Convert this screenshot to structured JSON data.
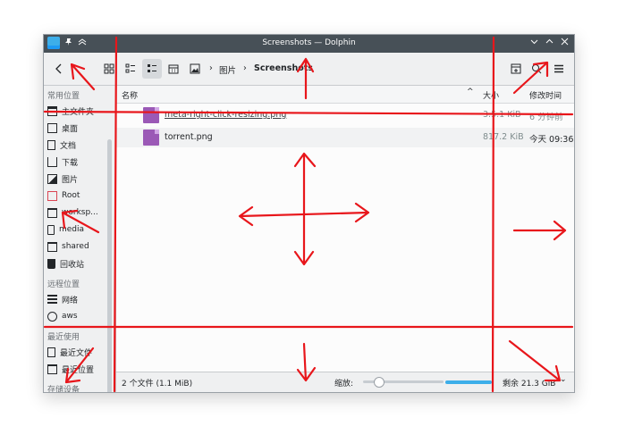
{
  "window": {
    "title": "Screenshots — Dolphin"
  },
  "breadcrumb": {
    "parent": "图片",
    "current": "Screenshots"
  },
  "sidebar": {
    "sections": [
      {
        "heading": "常用位置",
        "items": [
          "主文件夹",
          "桌面",
          "文档",
          "下载",
          "图片",
          "Root",
          "worksp...",
          "media",
          "shared",
          "回收站"
        ]
      },
      {
        "heading": "远程位置",
        "items": [
          "网络",
          "aws"
        ]
      },
      {
        "heading": "最近使用",
        "items": [
          "最近文件",
          "最近位置"
        ]
      },
      {
        "heading": "存储设备",
        "items": []
      }
    ]
  },
  "columns": {
    "name": "名称",
    "size": "大小",
    "modified": "修改时间"
  },
  "files": [
    {
      "name": "meta-right-click-resizing.png",
      "size": "3.5.1 KiB",
      "modified": "6 分钟前"
    },
    {
      "name": "torrent.png",
      "size": "817.2 KiB",
      "modified": "今天 09:36"
    }
  ],
  "status": {
    "summary": "2 个文件 (1.1 MiB)",
    "zoom_label": "缩放:",
    "free_space": "剩余 21.3 GiB",
    "zoom_level": 0.15
  },
  "colors": {
    "annotation": "#e8161b",
    "accent": "#3daee9",
    "titlebar": "#475057"
  }
}
